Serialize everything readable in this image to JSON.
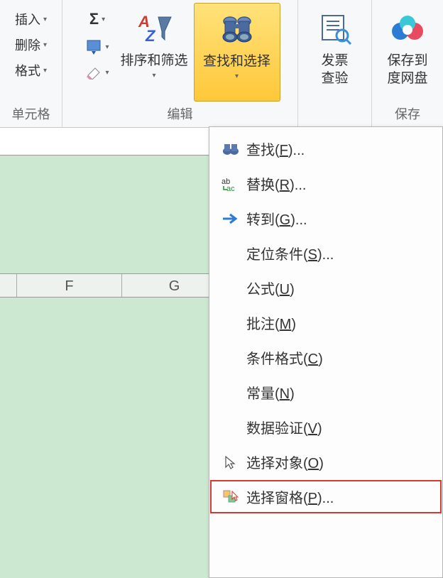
{
  "ribbon": {
    "cells_group": {
      "insert": "插入",
      "delete": "删除",
      "format": "格式",
      "label": "单元格"
    },
    "editing_group": {
      "sum_title": "Σ",
      "sort_filter": "排序和筛选",
      "find_select": "查找和选择",
      "label": "编辑"
    },
    "invoice_group": {
      "invoice": "发票\n查验"
    },
    "save_group": {
      "save": "保存到\n度网盘",
      "label": "保存"
    }
  },
  "dropdown": {
    "find": {
      "text": "查找(",
      "key": "F",
      "suffix": ")..."
    },
    "replace": {
      "text": "替换(",
      "key": "R",
      "suffix": ")..."
    },
    "goto": {
      "text": "转到(",
      "key": "G",
      "suffix": ")..."
    },
    "goto_special": {
      "text": "定位条件(",
      "key": "S",
      "suffix": ")..."
    },
    "formulas": {
      "text": "公式(",
      "key": "U",
      "suffix": ")"
    },
    "comments": {
      "text": "批注(",
      "key": "M",
      "suffix": ")"
    },
    "cond_fmt": {
      "text": "条件格式(",
      "key": "C",
      "suffix": ")"
    },
    "constants": {
      "text": "常量(",
      "key": "N",
      "suffix": ")"
    },
    "data_valid": {
      "text": "数据验证(",
      "key": "V",
      "suffix": ")"
    },
    "select_obj": {
      "text": "选择对象(",
      "key": "O",
      "suffix": ")"
    },
    "select_pane": {
      "text": "选择窗格(",
      "key": "P",
      "suffix": ")..."
    }
  },
  "columns": {
    "F": "F",
    "G": "G"
  }
}
